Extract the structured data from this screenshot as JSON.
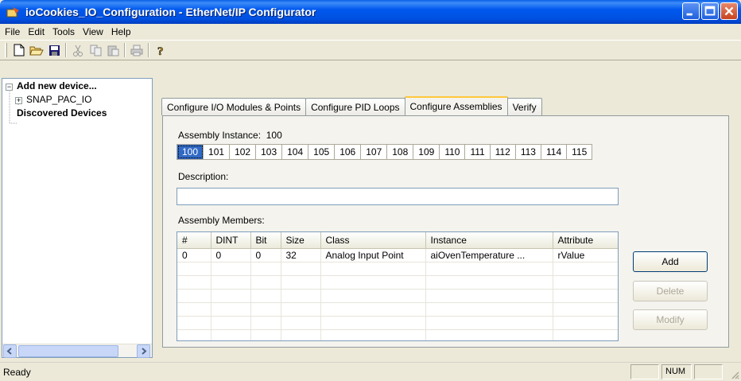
{
  "window": {
    "title": "ioCookies_IO_Configuration - EtherNet/IP Configurator"
  },
  "menu": [
    "File",
    "Edit",
    "Tools",
    "View",
    "Help"
  ],
  "toolbar": {
    "icons": [
      "new-file-icon",
      "open-folder-icon",
      "save-icon",
      "cut-icon",
      "copy-icon",
      "paste-icon",
      "print-icon",
      "help-icon"
    ]
  },
  "tree": {
    "root_label": "Add new device...",
    "child_label": "SNAP_PAC_IO",
    "discovered_label": "Discovered Devices"
  },
  "tabs": [
    {
      "label": "Configure I/O Modules & Points",
      "active": false
    },
    {
      "label": "Configure PID Loops",
      "active": false
    },
    {
      "label": "Configure Assemblies",
      "active": true
    },
    {
      "label": "Verify",
      "active": false
    }
  ],
  "assembly": {
    "instance_label": "Assembly Instance:",
    "instance_value": "100",
    "instances": [
      "100",
      "101",
      "102",
      "103",
      "104",
      "105",
      "106",
      "107",
      "108",
      "109",
      "110",
      "111",
      "112",
      "113",
      "114",
      "115"
    ],
    "selected_instance": "100",
    "description_label": "Description:",
    "description_value": "",
    "members_label": "Assembly Members:"
  },
  "members_table": {
    "columns": [
      "#",
      "DINT",
      "Bit",
      "Size",
      "Class",
      "Instance",
      "Attribute"
    ],
    "rows": [
      [
        "0",
        "0",
        "0",
        "32",
        "Analog Input Point",
        "aiOvenTemperature ...",
        "rValue"
      ]
    ]
  },
  "buttons": {
    "add": "Add",
    "delete": "Delete",
    "modify": "Modify"
  },
  "status": {
    "text": "Ready",
    "num": "NUM"
  }
}
